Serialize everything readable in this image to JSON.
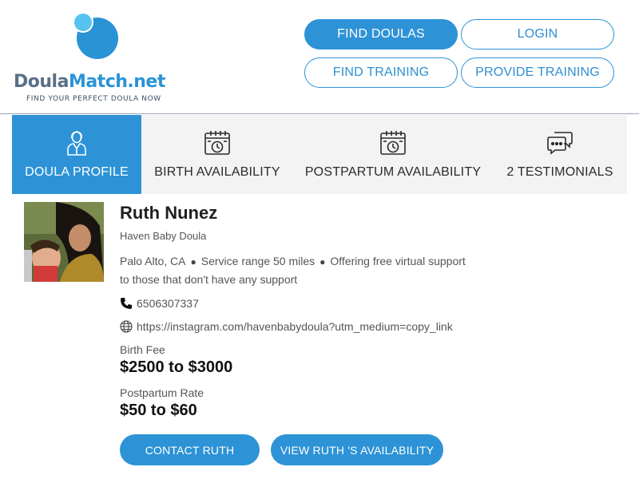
{
  "brand": {
    "name_part1": "Doula",
    "name_part2": "Match.net",
    "tagline": "FIND YOUR PERFECT DOULA NOW",
    "primary_color": "#2d93d6",
    "secondary_color": "#5a6f87"
  },
  "nav": {
    "find_doulas": "FIND DOULAS",
    "login": "LOGIN",
    "find_training": "FIND TRAINING",
    "provide_training": "PROVIDE TRAINING"
  },
  "tabs": [
    {
      "label": "DOULA PROFILE",
      "icon": "person-icon",
      "active": true
    },
    {
      "label": "BIRTH AVAILABILITY",
      "icon": "calendar-clock-icon",
      "active": false
    },
    {
      "label": "POSTPARTUM AVAILABILITY",
      "icon": "calendar-clock-icon",
      "active": false
    },
    {
      "label": "2 TESTIMONIALS",
      "icon": "chat-bubbles-icon",
      "active": false
    }
  ],
  "profile": {
    "name": "Ruth Nunez",
    "business": "Haven Baby Doula",
    "location": "Palo Alto, CA",
    "service_range": "Service range 50 miles",
    "virtual_support_1": "Offering free virtual support",
    "virtual_support_2": "to those that don't have any support",
    "phone": "6506307337",
    "website": "https://instagram.com/havenbabydoula?utm_medium=copy_link",
    "birth_fee_label": "Birth Fee",
    "birth_fee_value": "$2500 to $3000",
    "postpartum_label": "Postpartum Rate",
    "postpartum_value": "$50 to $60"
  },
  "actions": {
    "contact": "CONTACT RUTH",
    "availability": "VIEW RUTH 'S AVAILABILITY"
  }
}
